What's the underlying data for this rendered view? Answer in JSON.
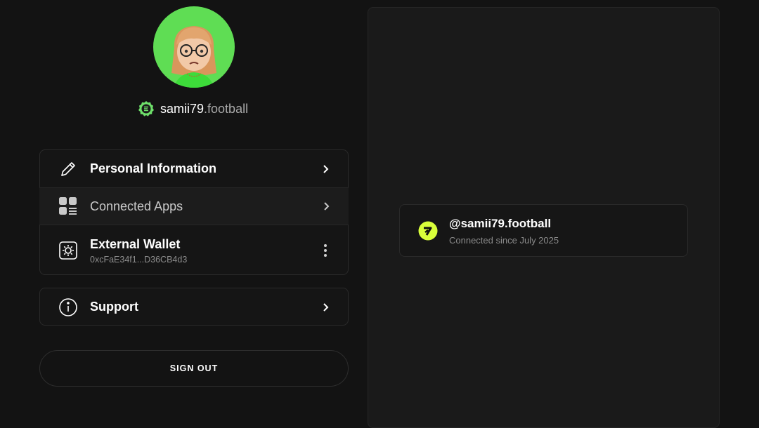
{
  "profile": {
    "handle": "samii79",
    "domain": ".football"
  },
  "menu": {
    "personal_info_label": "Personal Information",
    "connected_apps_label": "Connected Apps",
    "external_wallet_label": "External Wallet",
    "external_wallet_address": "0xcFaE34f1...D36CB4d3",
    "support_label": "Support"
  },
  "signout_label": "SIGN OUT",
  "connected_app": {
    "name": "@samii79.football",
    "since": "Connected since July 2025"
  },
  "colors": {
    "background": "#131313",
    "avatar_bg": "#5fdd54",
    "app_logo": "#d9ff3a"
  },
  "icons": [
    "pencil-icon",
    "apps-grid-icon",
    "wallet-gear-icon",
    "info-icon",
    "chevron-right-icon",
    "kebab-menu-icon",
    "verified-badge-icon",
    "app-logo-icon"
  ]
}
